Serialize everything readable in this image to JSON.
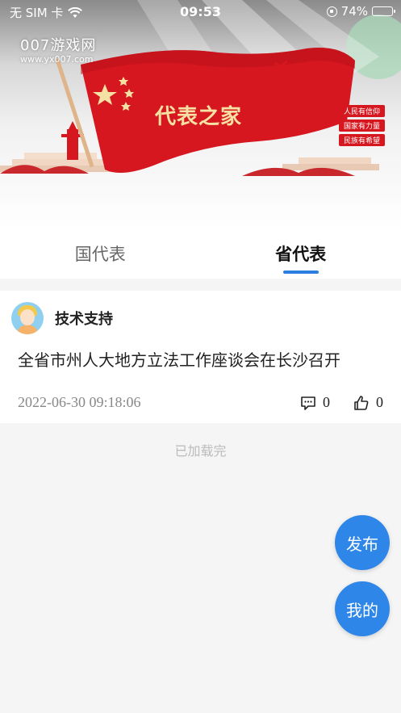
{
  "status_bar": {
    "carrier": "无 SIM 卡",
    "time": "09:53",
    "battery_percent": "74%",
    "battery_level": 0.74
  },
  "banner": {
    "watermark_title": "007游戏网",
    "watermark_url": "www.yx007.com",
    "caption": "代表之家",
    "slogans": [
      "人民有信仰",
      "国家有力量",
      "民族有希望"
    ],
    "colors": {
      "flag_red": "#d7171f",
      "caption_gold": "#f6e1a4"
    }
  },
  "tabs": [
    {
      "label": "国代表",
      "active": false
    },
    {
      "label": "省代表",
      "active": true
    }
  ],
  "post": {
    "author": "技术支持",
    "title": "全省市州人大地方立法工作座谈会在长沙召开",
    "time": "2022-06-30 09:18:06",
    "comment_count": "0",
    "like_count": "0"
  },
  "list_footer": "已加载完",
  "fabs": {
    "publish_label": "发布",
    "mine_label": "我的"
  },
  "accent_color": "#2e86e8"
}
